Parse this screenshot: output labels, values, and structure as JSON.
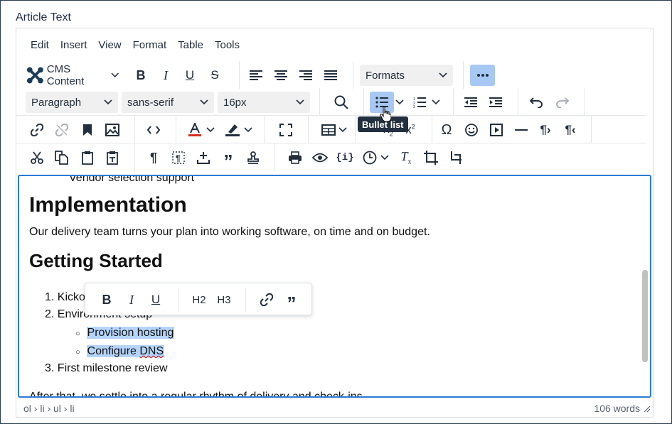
{
  "field_label": "Article Text",
  "menubar": [
    "Edit",
    "Insert",
    "View",
    "Format",
    "Table",
    "Tools"
  ],
  "toolbar": {
    "cms_content": "CMS Content",
    "formats": "Formats",
    "block_format": "Paragraph",
    "font_family": "sans-serif",
    "font_size": "16px",
    "tooltip": "Bullet list",
    "accent": "#a8c8f4"
  },
  "content": {
    "cut_line": "Vendor selection support",
    "heading1": "Implementation",
    "para1": "Our delivery team turns your plan into working software, on time and on budget.",
    "heading2": "Getting Started",
    "ol": [
      {
        "num": "1.",
        "text": "Kickoff"
      },
      {
        "num": "2.",
        "text": "Environment setup"
      },
      {
        "num": "3.",
        "text": "First milestone review"
      }
    ],
    "ul": [
      "Provision hosting",
      "Configure DNS"
    ],
    "para2": "After that, we settle into a regular rhythm of delivery and check-ins."
  },
  "quickbar": {
    "bold": "B",
    "italic": "I",
    "underline": "U",
    "h2": "H2",
    "h3": "H3"
  },
  "statusbar": {
    "path": "ol › li › ul › li",
    "word_count": "106 words"
  }
}
